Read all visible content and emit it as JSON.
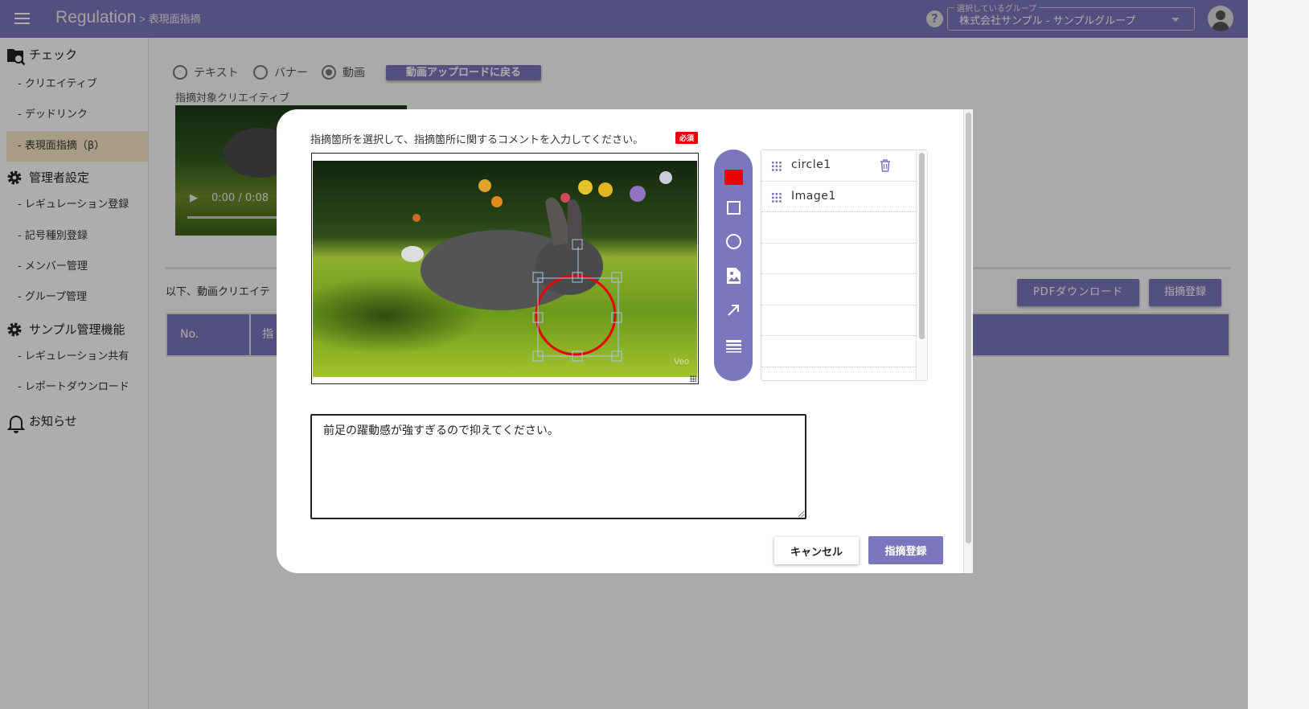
{
  "header": {
    "title": "Regulation",
    "breadcrumb": "> 表現面指摘",
    "group_label": "選択しているグループ",
    "group_value": "株式会社サンプル - サンプルグループ"
  },
  "sidebar": {
    "sections": [
      {
        "label": "チェック",
        "icon": "folder-search-icon",
        "items": [
          "- クリエイティブ",
          "- デッドリンク",
          "- 表現面指摘（β）"
        ]
      },
      {
        "label": "管理者設定",
        "icon": "gear-icon",
        "items": [
          "- レギュレーション登録",
          "- 記号種別登録",
          "- メンバー管理",
          "- グループ管理"
        ]
      },
      {
        "label": "サンプル管理機能",
        "icon": "gear-icon",
        "items": [
          "- レギュレーション共有",
          "- レポートダウンロード"
        ]
      },
      {
        "label": "お知らせ",
        "icon": "bell-icon",
        "items": []
      }
    ],
    "active_item": "- 表現面指摘（β）"
  },
  "main": {
    "radios": [
      {
        "label": "テキスト",
        "checked": false
      },
      {
        "label": "バナー",
        "checked": false
      },
      {
        "label": "動画",
        "checked": true
      }
    ],
    "back_button": "動画アップロードに戻る",
    "target_label": "指摘対象クリエイティブ",
    "video_time": "0:00 / 0:08",
    "list_intro": "以下、動画クリエイテ",
    "pdf_button": "PDFダウンロード",
    "register_button": "指摘登録",
    "table_headers": [
      "No.",
      "指"
    ]
  },
  "modal": {
    "instruction": "指摘箇所を選択して、指摘箇所に関するコメントを入力してください。",
    "required_badge": "必須",
    "watermark": "Veo",
    "tools": [
      "color-swatch",
      "rectangle",
      "circle",
      "image",
      "arrow",
      "line-weight"
    ],
    "tool_color": "#ee0000",
    "layers": [
      {
        "name": "circle1",
        "deletable": true
      },
      {
        "name": "Image1",
        "deletable": false
      }
    ],
    "comment": "前足の躍動感が強すぎるので抑えてください。",
    "cancel_button": "キャンセル",
    "submit_button": "指摘登録"
  },
  "colors": {
    "accent": "#7b76bd",
    "required": "#e8000b",
    "annotation": "#e60000"
  }
}
